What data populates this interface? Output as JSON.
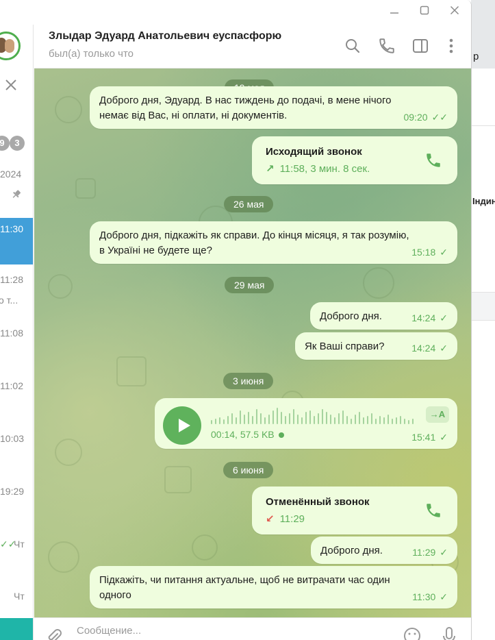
{
  "chat": {
    "title": "Злыдар Эдуард Анатольевич еуспасфорю",
    "status": "был(а) только что"
  },
  "sidebar": {
    "badge1": "9",
    "badge2": "3",
    "items": [
      {
        "time": "2024"
      },
      {
        "time": "11:30"
      },
      {
        "time": "11:28",
        "preview": "о т..."
      },
      {
        "time": "11:08"
      },
      {
        "time": "11:02"
      },
      {
        "time": "10:03"
      },
      {
        "time": "19:29"
      },
      {
        "time": "Чт"
      },
      {
        "time": "Чт"
      }
    ]
  },
  "background_app": {
    "text1": "р",
    "text2": "Індин"
  },
  "dates": {
    "d1": "19 мая",
    "d2": "26 мая",
    "d3": "29 мая",
    "d4": "3 июня",
    "d5": "6 июня"
  },
  "messages": [
    {
      "line1": "Доброго дня, Эдуард. В нас тиждень до подачі, в мене нічого",
      "line2": "немає від Вас, ні оплати, ні документів.",
      "time": "09:20",
      "status": "read"
    },
    {
      "title": "Исходящий звонок",
      "detail": "11:58, 3 мин. 8 сек.",
      "direction": "outgoing"
    },
    {
      "line1": "Доброго дня, підкажіть як справи. До кінця місяця, я так розумію,",
      "line2": "в Україні не будете ще?",
      "time": "15:18",
      "status": "sent"
    },
    {
      "text": "Доброго дня.",
      "time": "14:24",
      "status": "sent"
    },
    {
      "text": "Як Ваші справи?",
      "time": "14:24",
      "status": "sent"
    },
    {
      "voice_info": "00:14, 57.5 KB",
      "transcribe": "→A",
      "time": "15:41",
      "status": "sent"
    },
    {
      "title": "Отменённый звонок",
      "detail": "11:29",
      "direction": "cancelled"
    },
    {
      "text": "Доброго дня.",
      "time": "11:29",
      "status": "sent"
    },
    {
      "line1": "Підкажіть, чи питання актуальне, щоб не витрачати час один",
      "line2": "одного",
      "time": "11:30",
      "status": "sent"
    }
  ],
  "icons": {
    "read": "✓✓",
    "sent": "✓",
    "outgoing_arrow": "↗",
    "cancelled_arrow": "↙"
  },
  "composer": {
    "placeholder": "Сообщение..."
  },
  "colors": {
    "bubble": "#effdde",
    "accent_green": "#5eaf5b",
    "active_blue": "#419fd9",
    "missed_red": "#e05a4f"
  }
}
